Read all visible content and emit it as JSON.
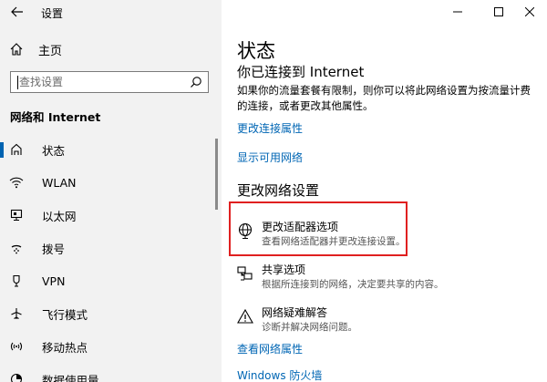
{
  "window": {
    "title": "设置",
    "controls": {
      "minimize": "—",
      "maximize": "☐",
      "close": "✕"
    }
  },
  "sidebar": {
    "home_label": "主页",
    "search_placeholder": "查找设置",
    "section_title": "网络和 Internet",
    "items": [
      {
        "label": "状态",
        "icon": "home-icon",
        "active": true
      },
      {
        "label": "WLAN",
        "icon": "wifi-icon",
        "active": false
      },
      {
        "label": "以太网",
        "icon": "ethernet-icon",
        "active": false
      },
      {
        "label": "拨号",
        "icon": "dialup-icon",
        "active": false
      },
      {
        "label": "VPN",
        "icon": "vpn-icon",
        "active": false
      },
      {
        "label": "飞行模式",
        "icon": "airplane-icon",
        "active": false
      },
      {
        "label": "移动热点",
        "icon": "hotspot-icon",
        "active": false
      },
      {
        "label": "数据使用量",
        "icon": "data-usage-icon",
        "active": false
      }
    ]
  },
  "main": {
    "title": "状态",
    "status_heading": "你已连接到 Internet",
    "status_description": "如果你的流量套餐有限制，则你可以将此网络设置为按流量计费的连接，或者更改其他属性。",
    "links": {
      "change_connection_properties": "更改连接属性",
      "show_available_networks": "显示可用网络",
      "view_network_properties": "查看网络属性",
      "windows_firewall": "Windows 防火墙"
    },
    "change_settings_heading": "更改网络设置",
    "options": [
      {
        "title": "更改适配器选项",
        "description": "查看网络适配器并更改连接设置。",
        "icon": "adapter-globe-icon"
      },
      {
        "title": "共享选项",
        "description": "根据所连接到的网络，决定要共享的内容。",
        "icon": "sharing-icon"
      },
      {
        "title": "网络疑难解答",
        "description": "诊断并解决网络问题。",
        "icon": "warning-icon"
      }
    ]
  },
  "colors": {
    "accent": "#0063b1",
    "link": "#0066b4",
    "highlight": "#e02020",
    "sidebar_bg": "#f2f2f2"
  }
}
